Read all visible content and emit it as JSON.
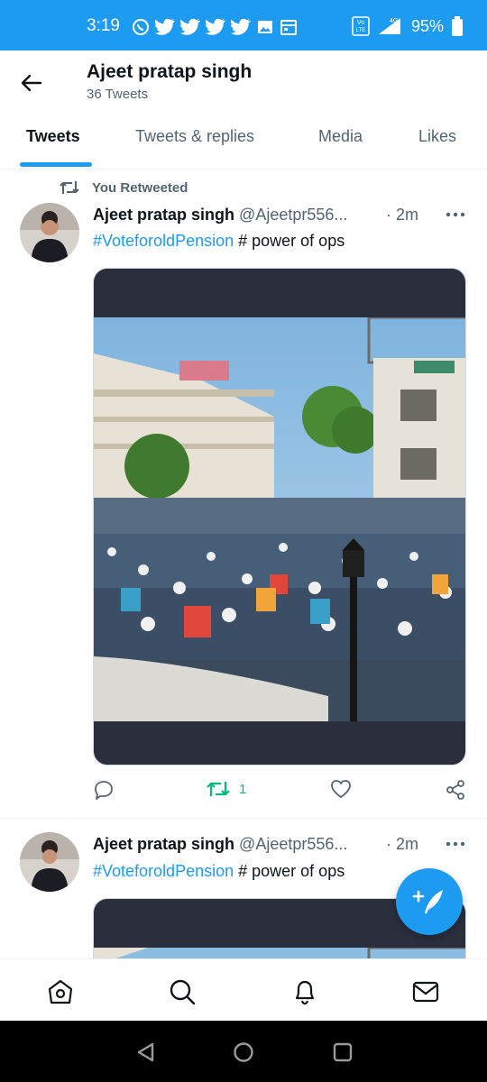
{
  "status_bar": {
    "time": "3:19",
    "battery": "95%",
    "network": "4G",
    "icons": [
      "whatsapp-icon",
      "twitter-icon",
      "twitter-icon",
      "twitter-icon",
      "twitter-icon",
      "gallery-icon",
      "calendar-icon",
      "volte-icon",
      "signal-icon",
      "battery-icon"
    ]
  },
  "header": {
    "title": "Ajeet pratap singh",
    "subtitle": "36 Tweets"
  },
  "tabs": [
    {
      "label": "Tweets",
      "active": true
    },
    {
      "label": "Tweets & replies",
      "active": false
    },
    {
      "label": "Media",
      "active": false
    },
    {
      "label": "Likes",
      "active": false
    }
  ],
  "tweets": [
    {
      "retweet_label": "You Retweeted",
      "name": "Ajeet pratap singh",
      "handle": "@Ajeetpr556...",
      "time": "· 2m",
      "hashtag": "#VoteforoldPension",
      "text": " # power of ops",
      "retweet_count": "1"
    },
    {
      "name": "Ajeet pratap singh",
      "handle": "@Ajeetpr556...",
      "time": "· 2m",
      "hashtag": "#VoteforoldPension",
      "text": " # power of ops"
    }
  ],
  "colors": {
    "accent": "#1d9bf0",
    "retweet_green": "#00ba7c",
    "secondary_text": "#536471"
  }
}
